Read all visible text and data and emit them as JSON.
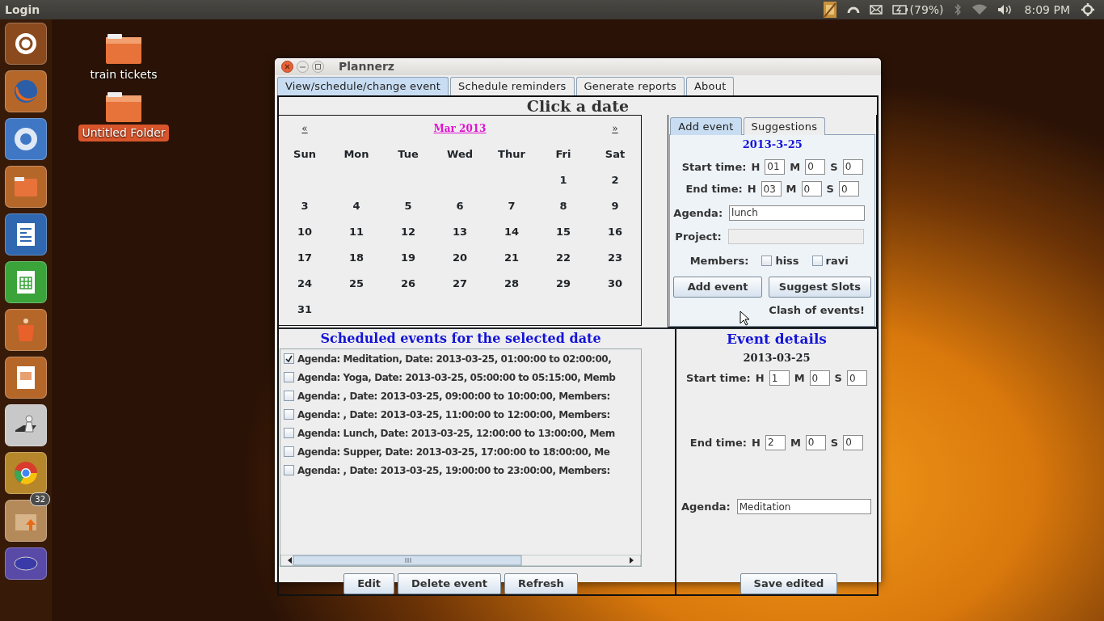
{
  "top_panel": {
    "app_name": "Login",
    "battery": "(79%)",
    "clock": "8:09 PM"
  },
  "launcher": {
    "badge": "32"
  },
  "desktop_icons": [
    {
      "label": "train tickets",
      "selected": false
    },
    {
      "label": "Untitled Folder",
      "selected": true
    }
  ],
  "window": {
    "title": "Plannerz",
    "tabs": [
      {
        "label": "View/schedule/change event",
        "selected": true
      },
      {
        "label": "Schedule reminders",
        "selected": false
      },
      {
        "label": "Generate reports",
        "selected": false
      },
      {
        "label": "About",
        "selected": false
      }
    ],
    "heading": "Click a date",
    "calendar": {
      "prev": "«",
      "month": "Mar 2013",
      "next": "»",
      "weekdays": [
        "Sun",
        "Mon",
        "Tue",
        "Wed",
        "Thur",
        "Fri",
        "Sat"
      ],
      "weeks": [
        [
          "1",
          "2"
        ],
        [
          "3",
          "4",
          "5",
          "6",
          "7",
          "8",
          "9"
        ],
        [
          "10",
          "11",
          "12",
          "13",
          "14",
          "15",
          "16"
        ],
        [
          "17",
          "18",
          "19",
          "20",
          "21",
          "22",
          "23"
        ],
        [
          "24",
          "25",
          "26",
          "27",
          "28",
          "29",
          "30"
        ],
        [
          "31"
        ]
      ]
    },
    "add_panel": {
      "tabs": [
        {
          "label": "Add event",
          "selected": true
        },
        {
          "label": "Suggestions",
          "selected": false
        }
      ],
      "date": "2013-3-25",
      "times": [
        {
          "label": "Start time:",
          "fields": [
            {
              "label": "H",
              "value": "01"
            },
            {
              "label": "M",
              "value": "0"
            },
            {
              "label": "S",
              "value": "0"
            }
          ]
        },
        {
          "label": "End time:",
          "fields": [
            {
              "label": "H",
              "value": "03"
            },
            {
              "label": "M",
              "value": "0"
            },
            {
              "label": "S",
              "value": "0"
            }
          ]
        }
      ],
      "agenda": {
        "label": "Agenda:",
        "value": "lunch"
      },
      "project": {
        "label": "Project:",
        "disabled": true
      },
      "members": {
        "label": "Members:",
        "options": [
          {
            "label": "hiss",
            "checked": false
          },
          {
            "label": "ravi",
            "checked": false
          }
        ]
      },
      "buttons": [
        "Add event",
        "Suggest Slots"
      ],
      "message": "Clash of events!"
    },
    "events": {
      "title": "Scheduled events for the selected date",
      "rows": [
        {
          "text": "Agenda: Meditation, Date: 2013-03-25, 01:00:00 to 02:00:00,",
          "checked": true
        },
        {
          "text": "Agenda: Yoga, Date: 2013-03-25, 05:00:00 to 05:15:00, Memb",
          "checked": false
        },
        {
          "text": "Agenda: , Date: 2013-03-25, 09:00:00 to 10:00:00, Members:",
          "checked": false
        },
        {
          "text": "Agenda: , Date: 2013-03-25, 11:00:00 to 12:00:00, Members:",
          "checked": false
        },
        {
          "text": "Agenda: Lunch, Date: 2013-03-25, 12:00:00 to 13:00:00, Mem",
          "checked": false
        },
        {
          "text": "Agenda: Supper, Date: 2013-03-25, 17:00:00 to 18:00:00, Me",
          "checked": false
        },
        {
          "text": "Agenda: , Date: 2013-03-25, 19:00:00 to 23:00:00, Members:",
          "checked": false
        }
      ],
      "buttons": [
        "Edit",
        "Delete event",
        "Refresh"
      ]
    },
    "details": {
      "title": "Event details",
      "date": "2013-03-25",
      "times": [
        {
          "label": "Start time:",
          "fields": [
            {
              "label": "H",
              "value": "1"
            },
            {
              "label": "M",
              "value": "0"
            },
            {
              "label": "S",
              "value": "0"
            }
          ]
        },
        {
          "label": "End time:",
          "fields": [
            {
              "label": "H",
              "value": "2"
            },
            {
              "label": "M",
              "value": "0"
            },
            {
              "label": "S",
              "value": "0"
            }
          ]
        }
      ],
      "agenda": {
        "label": "Agenda:",
        "value": "Meditation"
      },
      "button": "Save edited"
    }
  }
}
